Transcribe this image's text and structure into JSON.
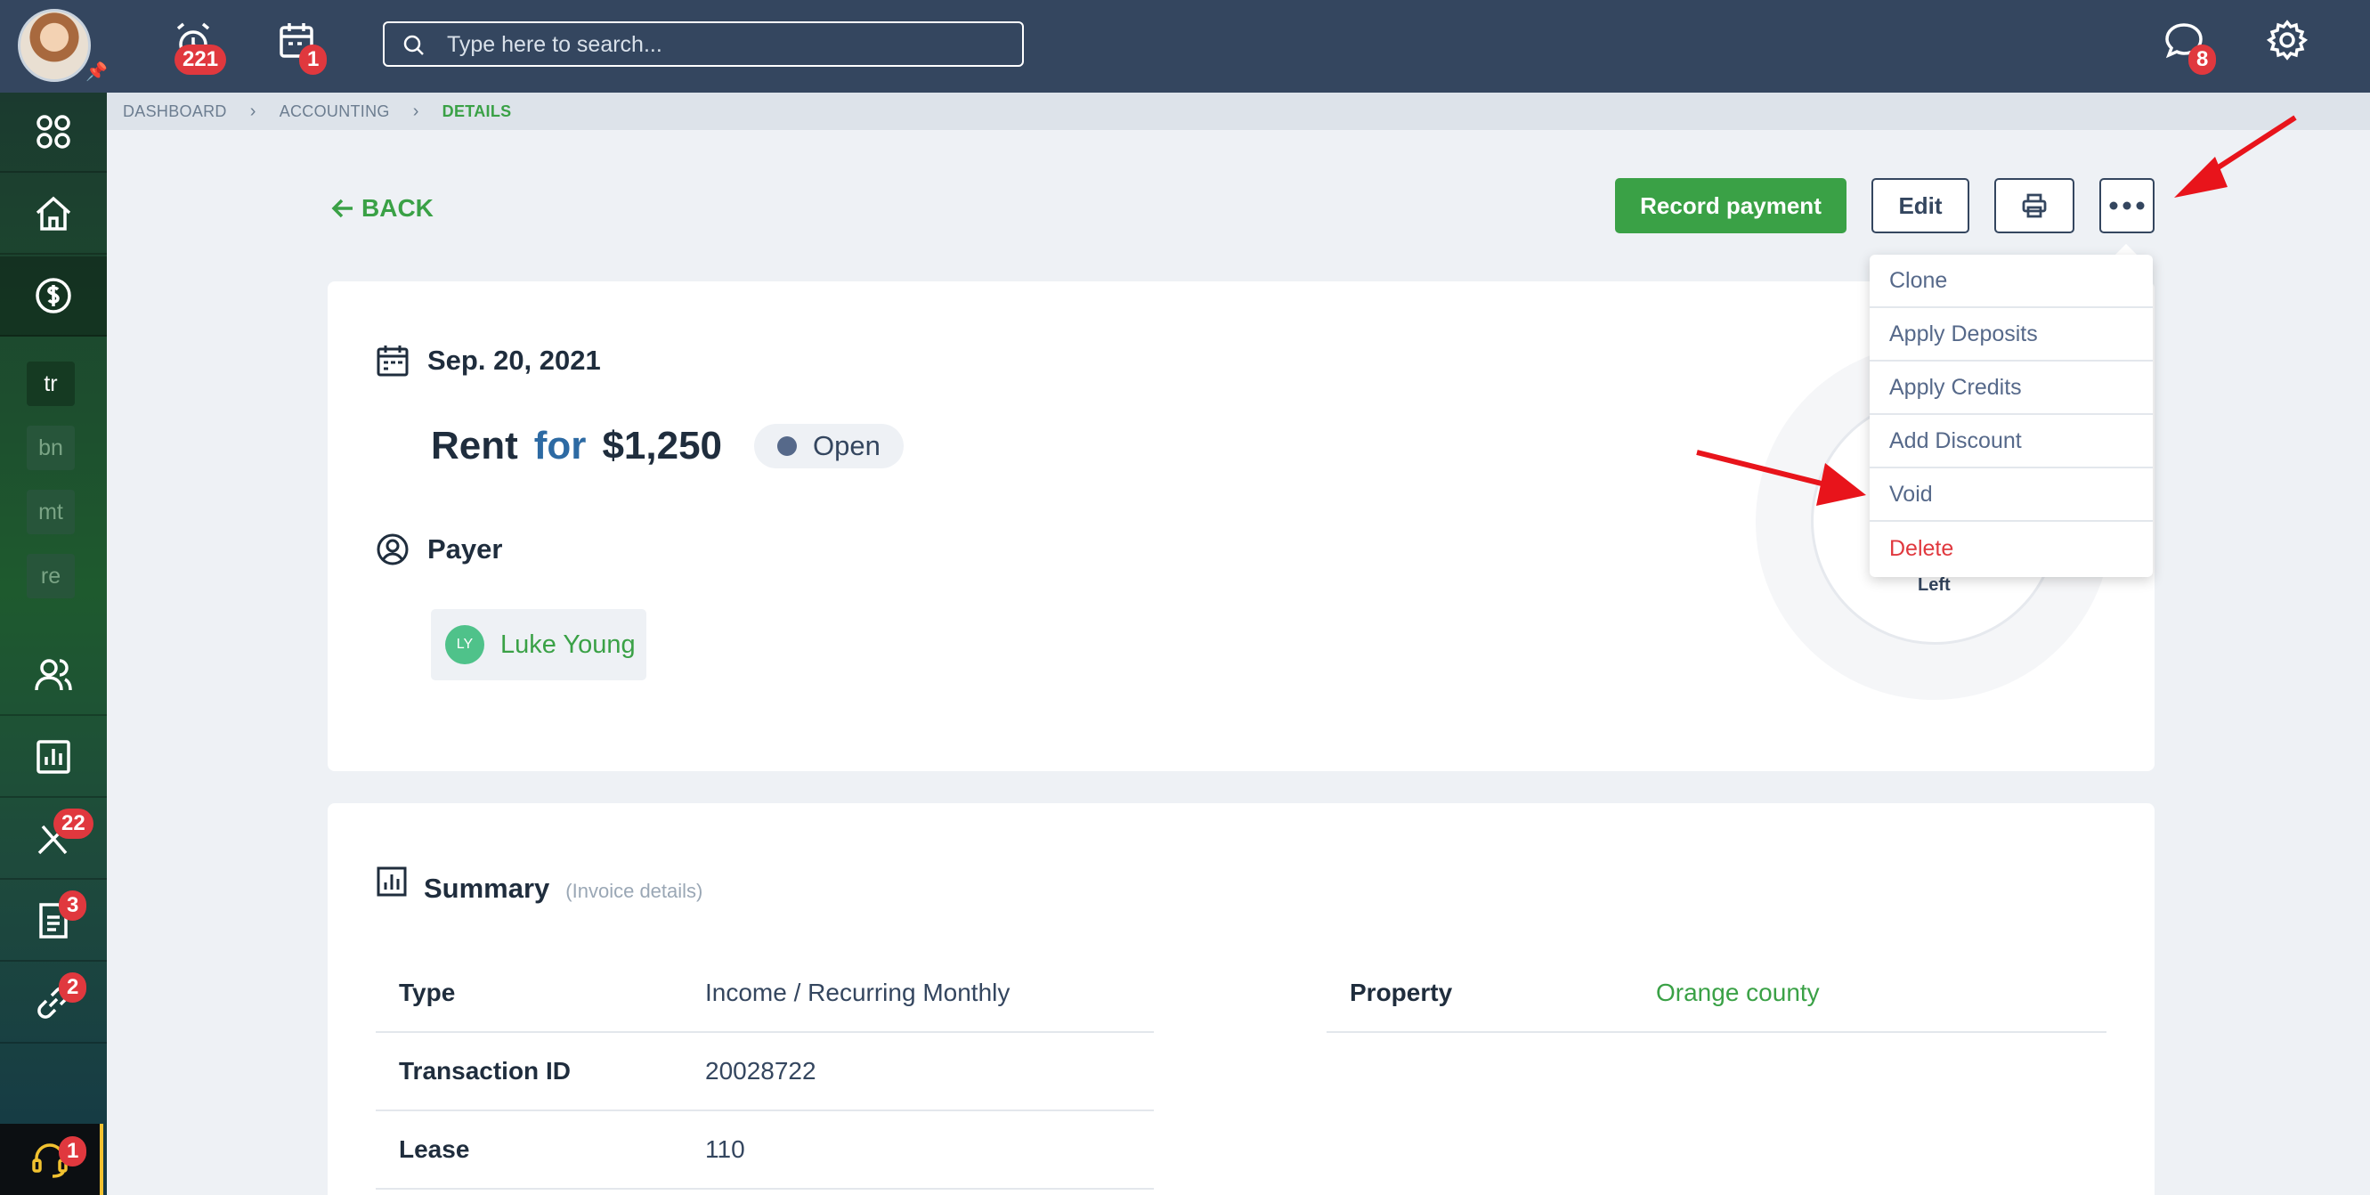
{
  "topbar": {
    "alerts_badge": "221",
    "calendar_badge": "1",
    "search_placeholder": "Type here to search...",
    "messages_badge": "8"
  },
  "sidebar": {
    "shortcuts": [
      "tr",
      "bn",
      "mt",
      "re"
    ],
    "tools_badge": "22",
    "docs_badge": "3",
    "links_badge": "2",
    "support_badge": "1"
  },
  "breadcrumb": [
    "DASHBOARD",
    "ACCOUNTING",
    "DETAILS"
  ],
  "actions": {
    "back": "BACK",
    "record_payment": "Record payment",
    "edit": "Edit"
  },
  "more_menu": [
    "Clone",
    "Apply Deposits",
    "Apply Credits",
    "Add Discount",
    "Void",
    "Delete"
  ],
  "transaction": {
    "date": "Sep. 20, 2021",
    "category": "Rent",
    "for_word": "for",
    "amount": "$1,250",
    "status": "Open",
    "payer_heading": "Payer",
    "payer_initials": "LY",
    "payer_name": "Luke Young",
    "donut_label": "Left"
  },
  "summary": {
    "title": "Summary",
    "subtitle": "(Invoice details)",
    "left_rows": [
      {
        "label": "Type",
        "value": "Income / Recurring Monthly"
      },
      {
        "label": "Transaction ID",
        "value": "20028722"
      },
      {
        "label": "Lease",
        "value": "110"
      }
    ],
    "right_rows": [
      {
        "label": "Property",
        "value": "Orange county"
      }
    ]
  },
  "colors": {
    "brand_green": "#3aa146",
    "topbar": "#34465f",
    "danger": "#e0383e",
    "annotation": "#e8141b"
  }
}
